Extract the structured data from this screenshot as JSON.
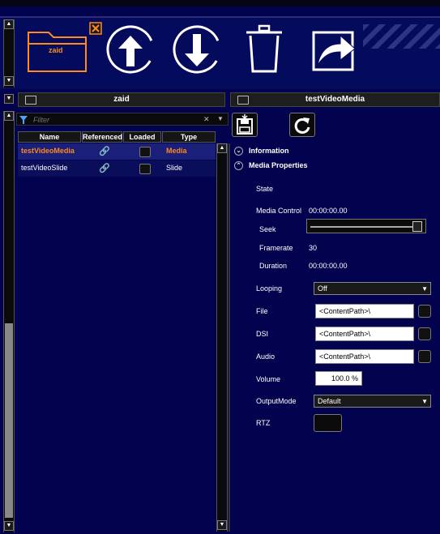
{
  "toolbar": {
    "folder_label": "zaid",
    "icons": [
      "folder-icon",
      "close-icon",
      "upload-arrow-icon",
      "download-arrow-icon",
      "trash-icon",
      "share-icon"
    ]
  },
  "left_header": {
    "title": "zaid"
  },
  "right_header": {
    "title": "testVideoMedia"
  },
  "filter": {
    "placeholder": "Filter"
  },
  "columns": [
    "Name",
    "Referenced",
    "Loaded",
    "Type"
  ],
  "rows": [
    {
      "name": "testVideoMedia",
      "type": "Media",
      "selected": true
    },
    {
      "name": "testVideoSlide",
      "type": "Slide",
      "selected": false
    }
  ],
  "sections": {
    "information": "Information",
    "media_properties": "Media Properties"
  },
  "props": {
    "state": "State",
    "media_control": "Media Control",
    "media_control_value": "00:00:00.00",
    "seek": "Seek",
    "framerate": "Framerate",
    "framerate_value": "30",
    "duration": "Duration",
    "duration_value": "00:00:00.00",
    "looping": "Looping",
    "looping_value": "Off",
    "file": "File",
    "file_value": "<ContentPath>\\",
    "dsi": "DSI",
    "dsi_value": "<ContentPath>\\",
    "audio": "Audio",
    "audio_value": "<ContentPath>\\",
    "volume": "Volume",
    "volume_value": "100.0 %",
    "output_mode": "OutputMode",
    "output_mode_value": "Default",
    "rtz": "RTZ"
  },
  "colors": {
    "background": "#02024f",
    "selected_text": "#ff8a1f",
    "toolbar_bg": "#040b5c"
  }
}
